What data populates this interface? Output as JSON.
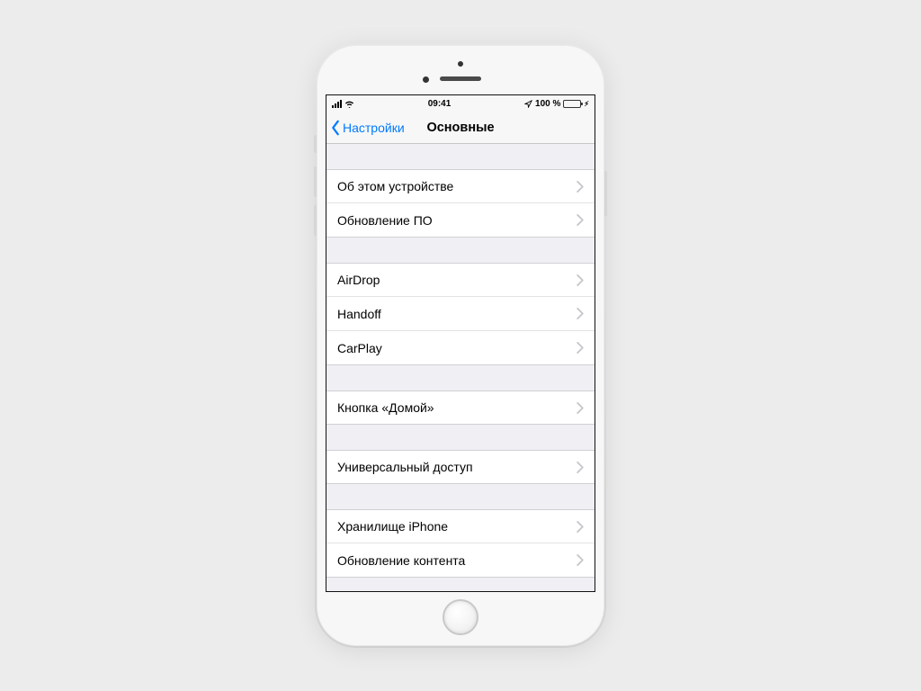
{
  "status_bar": {
    "time": "09:41",
    "battery_text": "100 %"
  },
  "nav": {
    "back_label": "Настройки",
    "title": "Основные"
  },
  "groups": [
    {
      "items": [
        {
          "name": "row-about",
          "label": "Об этом устройстве"
        },
        {
          "name": "row-software-update",
          "label": "Обновление ПО"
        }
      ]
    },
    {
      "items": [
        {
          "name": "row-airdrop",
          "label": "AirDrop"
        },
        {
          "name": "row-handoff",
          "label": "Handoff"
        },
        {
          "name": "row-carplay",
          "label": "CarPlay"
        }
      ]
    },
    {
      "items": [
        {
          "name": "row-home-button",
          "label": "Кнопка «Домой»"
        }
      ]
    },
    {
      "items": [
        {
          "name": "row-accessibility",
          "label": "Универсальный доступ"
        }
      ]
    },
    {
      "items": [
        {
          "name": "row-iphone-storage",
          "label": "Хранилище iPhone"
        },
        {
          "name": "row-background-refresh",
          "label": "Обновление контента"
        }
      ]
    }
  ]
}
